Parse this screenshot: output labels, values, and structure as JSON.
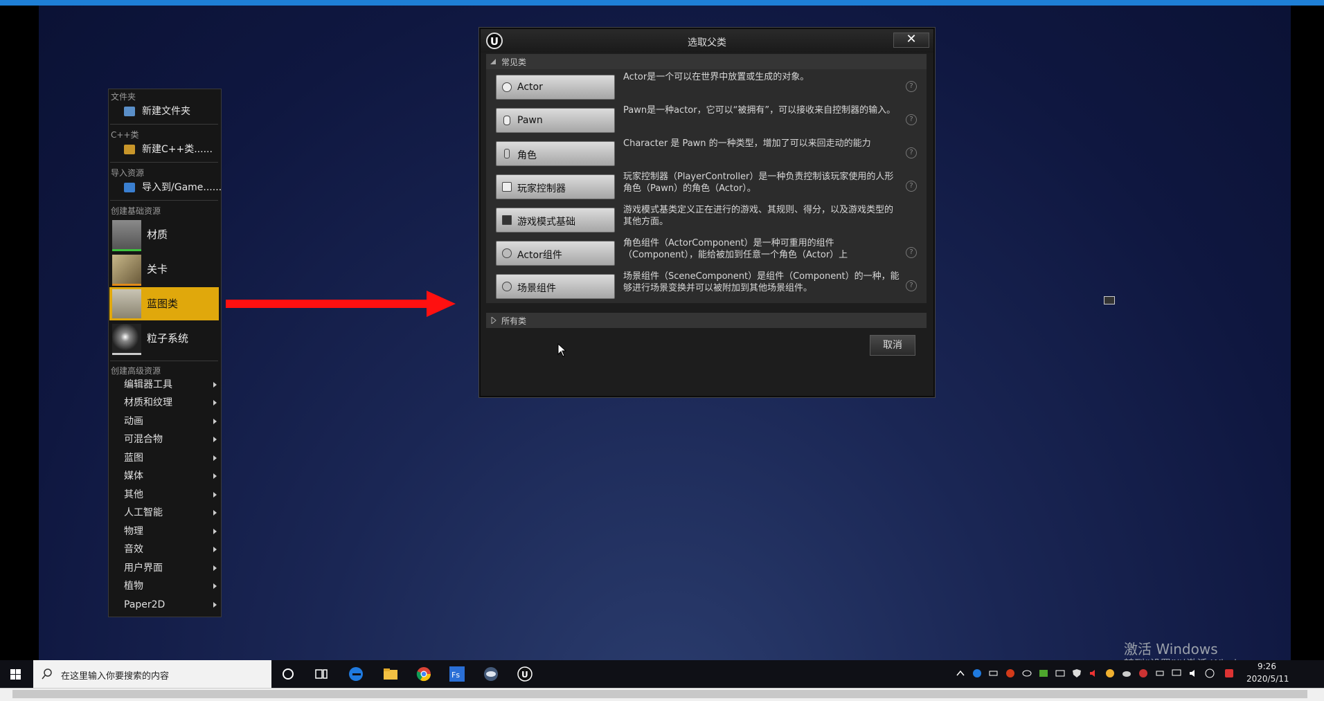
{
  "context_menu": {
    "sec_folder": "文件夹",
    "new_folder": "新建文件夹",
    "sec_cpp": "C++类",
    "new_cpp": "新建C++类......",
    "sec_import": "导入资源",
    "import_to": "导入到/Game......",
    "sec_basic": "创建基础资源",
    "basic_items": [
      {
        "label": "材质"
      },
      {
        "label": "关卡"
      },
      {
        "label": "蓝图类"
      },
      {
        "label": "粒子系统"
      }
    ],
    "sec_advanced": "创建高级资源",
    "advanced_items": [
      {
        "label": "编辑器工具"
      },
      {
        "label": "材质和纹理"
      },
      {
        "label": "动画"
      },
      {
        "label": "可混合物"
      },
      {
        "label": "蓝图"
      },
      {
        "label": "媒体"
      },
      {
        "label": "其他"
      },
      {
        "label": "人工智能"
      },
      {
        "label": "物理"
      },
      {
        "label": "音效"
      },
      {
        "label": "用户界面"
      },
      {
        "label": "植物"
      },
      {
        "label": "Paper2D"
      }
    ],
    "active_item": "蓝图类",
    "active_color": "#e0a80c"
  },
  "dialog": {
    "title": "选取父类",
    "close": "✕",
    "common_header": "常见类",
    "classes": [
      {
        "name": "Actor",
        "desc": "Actor是一个可以在世界中放置或生成的对象。",
        "help": "?"
      },
      {
        "name": "Pawn",
        "desc": "Pawn是一种actor，它可以“被拥有”，可以接收来自控制器的输入。",
        "help": "?"
      },
      {
        "name": "角色",
        "desc": "Character 是 Pawn 的一种类型，增加了可以来回走动的能力",
        "help": "?"
      },
      {
        "name": "玩家控制器",
        "desc": "玩家控制器（PlayerController）是一种负责控制该玩家使用的人形角色（Pawn）的角色（Actor）。",
        "help": "?"
      },
      {
        "name": "游戏模式基础",
        "desc": "游戏模式基类定义正在进行的游戏、其规则、得分，以及游戏类型的其他方面。",
        "help": ""
      },
      {
        "name": "Actor组件",
        "desc": "角色组件（ActorComponent）是一种可重用的组件（Component），能给被加到任意一个角色（Actor）上",
        "help": "?"
      },
      {
        "name": "场景组件",
        "desc": "场景组件（SceneComponent）是组件（Component）的一种，能够进行场景变换并可以被附加到其他场景组件。",
        "help": "?"
      }
    ],
    "all_classes_header": "所有类",
    "cancel": "取消"
  },
  "watermark": {
    "line1": "激活 Windows",
    "line2": "转到“设置”以激活 Windows。"
  },
  "taskbar": {
    "search_placeholder": "在这里输入你要搜索的内容",
    "apps": [
      "cortana-icon",
      "task-view-icon",
      "edge-icon",
      "file-explorer-icon",
      "chrome-icon",
      "fs-icon",
      "vr-icon",
      "unreal-icon"
    ],
    "clock_time": "9:26",
    "clock_date": "2020/5/11"
  },
  "colors": {
    "accent_blue": "#1e7fd6",
    "arrow_red": "#ff1010"
  }
}
